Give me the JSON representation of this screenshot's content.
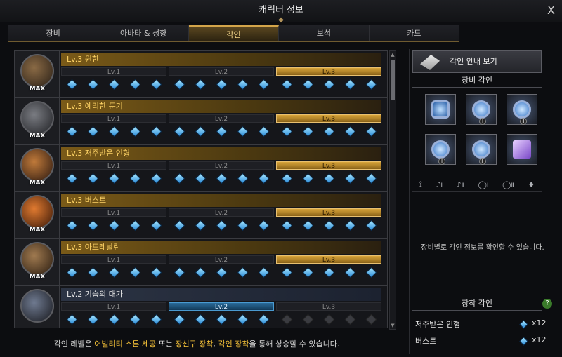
{
  "window": {
    "title": "캐릭터 정보",
    "close_label": "X"
  },
  "tabs": [
    {
      "label": "장비"
    },
    {
      "label": "아바타 & 성향"
    },
    {
      "label": "각인",
      "active": true
    },
    {
      "label": "보석"
    },
    {
      "label": "카드"
    }
  ],
  "engravings": [
    {
      "title": "Lv.3 원한",
      "level": 3,
      "badge": "MAX",
      "gems": 15
    },
    {
      "title": "Lv.3 예리한 둔기",
      "level": 3,
      "badge": "MAX",
      "gems": 15
    },
    {
      "title": "Lv.3 저주받은 인형",
      "level": 3,
      "badge": "MAX",
      "gems": 15
    },
    {
      "title": "Lv.3 버스트",
      "level": 3,
      "badge": "MAX",
      "gems": 15
    },
    {
      "title": "Lv.3 아드레날린",
      "level": 3,
      "badge": "MAX",
      "gems": 15
    },
    {
      "title": "Lv.2 기습의 대가",
      "level": 2,
      "badge": "",
      "gems": 10
    }
  ],
  "level_labels": [
    "Lv.1",
    "Lv.2",
    "Lv.3"
  ],
  "footer": {
    "prefix": "각인 레벨은 ",
    "hl1": "어빌리티 스톤 세공",
    "mid": " 또는 ",
    "hl2": "장신구 장착",
    "comma": ", ",
    "hl3": "각인 장착",
    "suffix": "을 통해 상승할 수 있습니다."
  },
  "side": {
    "guide_button": "각인 안내 보기",
    "equip_section": "장비 각인",
    "slot_icons": [
      "necklace-icon",
      "earring-1-icon",
      "earring-2-icon",
      "ring-1-icon",
      "ring-2-icon",
      "ability-stone-icon"
    ],
    "slot_numbers": [
      "",
      "Ⅰ",
      "Ⅱ",
      "Ⅰ",
      "Ⅱ",
      ""
    ],
    "filter_labels": [
      "Ⅰ",
      "Ⅱ",
      "Ⅰ",
      "Ⅱ"
    ],
    "note": "장비별로 각인 정보를 확인할 수 있습니다.",
    "equipped_section": "장착 각인",
    "help": "?",
    "equipped": [
      {
        "name": "저주받은 인형",
        "count": "x12"
      },
      {
        "name": "버스트",
        "count": "x12"
      }
    ]
  },
  "colors": {
    "gold": "#d9a53a",
    "blue": "#2a6c9a",
    "accent": "#ffc93a"
  }
}
